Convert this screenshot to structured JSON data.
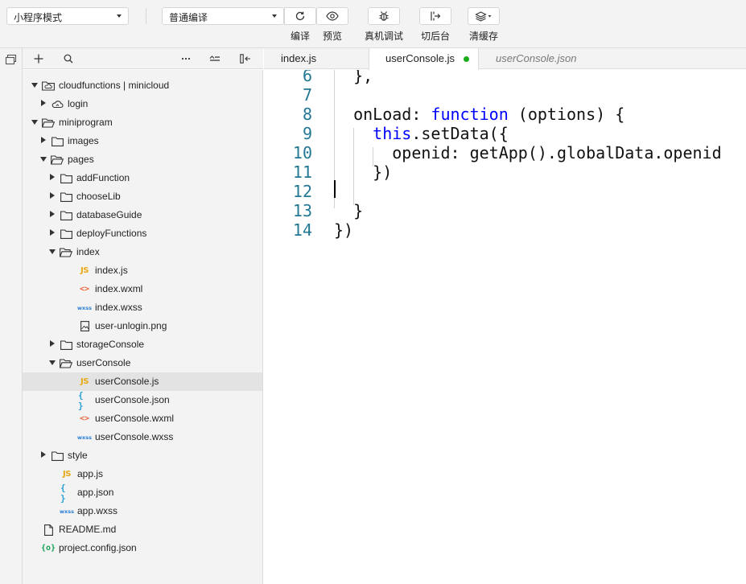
{
  "toolbar": {
    "mode_select": "小程序模式",
    "compile_select": "普通编译",
    "buttons": [
      {
        "label": "编译",
        "icon": "refresh-icon"
      },
      {
        "label": "预览",
        "icon": "eye-icon"
      },
      {
        "label": "真机调试",
        "icon": "bug-icon"
      },
      {
        "label": "切后台",
        "icon": "switch-background-icon"
      },
      {
        "label": "清缓存",
        "icon": "layers-icon"
      }
    ]
  },
  "sidebar": {
    "header_icons": [
      "add-icon",
      "search-icon",
      "more-icon",
      "collapse-all-icon",
      "split-icon"
    ],
    "tree": [
      {
        "label": "cloudfunctions | minicloud",
        "icon": "cloud-folder-icon",
        "depth": 0,
        "expanded": true
      },
      {
        "label": "login",
        "icon": "cloud-icon",
        "depth": 1,
        "expanded": false
      },
      {
        "label": "miniprogram",
        "icon": "folder-open-icon",
        "depth": 0,
        "expanded": true
      },
      {
        "label": "images",
        "icon": "folder-icon",
        "depth": 1,
        "expanded": false
      },
      {
        "label": "pages",
        "icon": "folder-open-icon",
        "depth": 1,
        "expanded": true
      },
      {
        "label": "addFunction",
        "icon": "folder-icon",
        "depth": 2,
        "expanded": false
      },
      {
        "label": "chooseLib",
        "icon": "folder-icon",
        "depth": 2,
        "expanded": false
      },
      {
        "label": "databaseGuide",
        "icon": "folder-icon",
        "depth": 2,
        "expanded": false
      },
      {
        "label": "deployFunctions",
        "icon": "folder-icon",
        "depth": 2,
        "expanded": false
      },
      {
        "label": "index",
        "icon": "folder-open-icon",
        "depth": 2,
        "expanded": true
      },
      {
        "label": "index.js",
        "icon": "js-file-icon",
        "depth": 3
      },
      {
        "label": "index.wxml",
        "icon": "wxml-file-icon",
        "depth": 3
      },
      {
        "label": "index.wxss",
        "icon": "wxss-file-icon",
        "depth": 3
      },
      {
        "label": "user-unlogin.png",
        "icon": "image-file-icon",
        "depth": 3
      },
      {
        "label": "storageConsole",
        "icon": "folder-icon",
        "depth": 2,
        "expanded": false
      },
      {
        "label": "userConsole",
        "icon": "folder-open-icon",
        "depth": 2,
        "expanded": true
      },
      {
        "label": "userConsole.js",
        "icon": "js-file-icon",
        "depth": 3,
        "selected": true
      },
      {
        "label": "userConsole.json",
        "icon": "json-file-icon",
        "depth": 3
      },
      {
        "label": "userConsole.wxml",
        "icon": "wxml-file-icon",
        "depth": 3
      },
      {
        "label": "userConsole.wxss",
        "icon": "wxss-file-icon",
        "depth": 3
      },
      {
        "label": "style",
        "icon": "folder-icon",
        "depth": 1,
        "expanded": false
      },
      {
        "label": "app.js",
        "icon": "js-file-icon",
        "depth": 1
      },
      {
        "label": "app.json",
        "icon": "json-file-icon",
        "depth": 1
      },
      {
        "label": "app.wxss",
        "icon": "wxss-file-icon",
        "depth": 1
      },
      {
        "label": "README.md",
        "icon": "document-file-icon",
        "depth": 0
      },
      {
        "label": "project.config.json",
        "icon": "config-file-icon",
        "depth": 0
      }
    ]
  },
  "editor": {
    "tabs": [
      {
        "label": "index.js",
        "active": false,
        "italic": false
      },
      {
        "label": "userConsole.js",
        "active": true,
        "italic": false,
        "modified": true
      },
      {
        "label": "userConsole.json",
        "active": false,
        "italic": true
      }
    ],
    "code": [
      {
        "line": "6",
        "text": "  },"
      },
      {
        "line": "7",
        "text": ""
      },
      {
        "line": "8",
        "text": "  onLoad: function (options) {"
      },
      {
        "line": "9",
        "text": "    this.setData({"
      },
      {
        "line": "10",
        "text": "      openid: getApp().globalData.openid"
      },
      {
        "line": "11",
        "text": "    })"
      },
      {
        "line": "12",
        "text": ""
      },
      {
        "line": "13",
        "text": "  }"
      },
      {
        "line": "14",
        "text": "})"
      }
    ],
    "cursor_line": "12"
  }
}
